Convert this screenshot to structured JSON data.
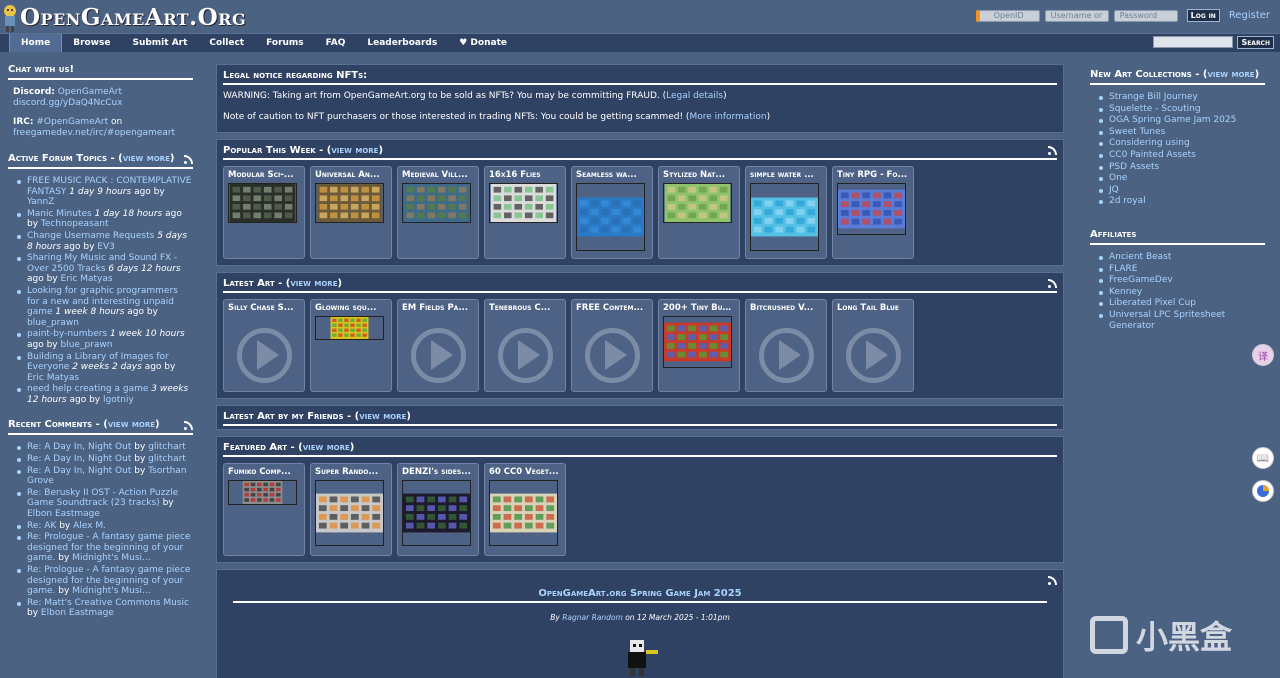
{
  "site": {
    "title": "OpenGameArt.Org"
  },
  "login": {
    "openid_placeholder": "OpenID",
    "username_placeholder": "Username or",
    "password_placeholder": "Password",
    "login_label": "Log in",
    "register_label": "Register"
  },
  "nav": {
    "items": [
      "Home",
      "Browse",
      "Submit Art",
      "Collect",
      "Forums",
      "FAQ",
      "Leaderboards",
      "♥ Donate"
    ],
    "search_label": "Search"
  },
  "chat": {
    "heading": "Chat with us!",
    "discord_label": "Discord:",
    "discord_name": "OpenGameArt",
    "discord_link": "discord.gg/yDaQ4NcCux",
    "irc_label": "IRC:",
    "irc_channel": "#OpenGameArt",
    "irc_on": "on",
    "irc_link": "freegamedev.net/irc/#opengameart"
  },
  "forum": {
    "heading": "Active Forum Topics - (",
    "view_more": "view more",
    "close": ")",
    "items": [
      {
        "title": "FREE MUSIC PACK : CONTEMPLATIVE FANTASY",
        "time": "1 day 9 hours",
        "ago": "ago by",
        "user": "YannZ"
      },
      {
        "title": "Manic Minutes",
        "time": "1 day 18 hours",
        "ago": "ago by",
        "user": "Technopeasant"
      },
      {
        "title": "Change Username Requests",
        "time": "5 days 8 hours",
        "ago": "ago by",
        "user": "EV3"
      },
      {
        "title": "Sharing My Music and Sound FX - Over 2500 Tracks",
        "time": "6 days 12 hours",
        "ago": "ago by",
        "user": "Eric Matyas"
      },
      {
        "title": "Looking for graphic programmers for a new and interesting unpaid game",
        "time": "1 week 8 hours",
        "ago": "ago by",
        "user": "blue_prawn"
      },
      {
        "title": "paint-by-numbers",
        "time": "1 week 10 hours",
        "ago": "ago by",
        "user": "blue_prawn"
      },
      {
        "title": "Building a Library of Images for Everyone",
        "time": "2 weeks 2 days",
        "ago": "ago by",
        "user": "Eric Matyas"
      },
      {
        "title": "need help creating a game",
        "time": "3 weeks 12 hours",
        "ago": "ago by",
        "user": "lgotniy"
      }
    ]
  },
  "comments": {
    "heading": "Recent Comments - (",
    "view_more": "view more",
    "close": ")",
    "items": [
      {
        "title": "Re: A Day In, Night Out",
        "by": "by",
        "user": "glitchart"
      },
      {
        "title": "Re: A Day In, Night Out",
        "by": "by",
        "user": "glitchart"
      },
      {
        "title": "Re: A Day In, Night Out",
        "by": "by",
        "user": "Tsorthan Grove"
      },
      {
        "title": "Re: Berusky II OST - Action Puzzle Game Soundtrack (23 tracks)",
        "by": "by",
        "user": "Elbon Eastmage"
      },
      {
        "title": "Re: AK",
        "by": "by",
        "user": "Alex M."
      },
      {
        "title": "Re: Prologue - A fantasy game piece designed for the beginning of your game.",
        "by": "by",
        "user": "Midnight's Musi..."
      },
      {
        "title": "Re: Prologue - A fantasy game piece designed for the beginning of your game.",
        "by": "by",
        "user": "Midnight's Musi..."
      },
      {
        "title": "Re: Matt's Creative Commons Music",
        "by": "by",
        "user": "Elbon Eastmage"
      }
    ]
  },
  "legal": {
    "heading": "Legal notice regarding NFTs:",
    "warning": "WARNING: Taking art from OpenGameArt.org to be sold as NFTs? You may be committing FRAUD. (",
    "warning_link": "Legal details",
    "note": "Note of caution to NFT purchasers or those interested in trading NFTs: You could be getting scammed! (",
    "note_link": "More information",
    "close": ")"
  },
  "popular": {
    "heading": "Popular This Week - (",
    "view_more": "view more",
    "close": ")",
    "items": [
      {
        "title": "Modular Sci-...",
        "colors": [
          "#2b2f2a",
          "#5d6a55",
          "#8b9a86"
        ]
      },
      {
        "title": "Universal An...",
        "colors": [
          "#6b5a3a",
          "#d9a441",
          "#e7c06a"
        ]
      },
      {
        "title": "Medieval Vill...",
        "colors": [
          "#3e6b8a",
          "#5b7f3a",
          "#9b7c52"
        ]
      },
      {
        "title": "16x16 Flies",
        "colors": [
          "#dcdcdc",
          "#3b3b3b",
          "#6dbf7b"
        ]
      },
      {
        "title": "Seamless wa...",
        "colors": [
          "#2a7ac8",
          "#3a8fd8",
          "#2b6db3"
        ]
      },
      {
        "title": "Stylized Nat...",
        "colors": [
          "#8fc36b",
          "#d8c48a",
          "#6b9b49"
        ]
      },
      {
        "title": "simple water ...",
        "colors": [
          "#55c0e6",
          "#2aa1d4",
          "#8fd8f0"
        ]
      },
      {
        "title": "Tiny RPG - Fo...",
        "colors": [
          "#5a7bd6",
          "#2e4fae",
          "#c44"
        ]
      }
    ]
  },
  "latest": {
    "heading": "Latest Art - (",
    "view_more": "view more",
    "close": ")",
    "items": [
      {
        "title": "Silly Chase S...",
        "kind": "audio"
      },
      {
        "title": "Glowing squ...",
        "kind": "image",
        "colors": [
          "#d8c41a",
          "#c83b2b",
          "#46a83a"
        ]
      },
      {
        "title": "EM Fields Pa...",
        "kind": "audio"
      },
      {
        "title": "Tenebrous C...",
        "kind": "audio"
      },
      {
        "title": "FREE Contem...",
        "kind": "audio"
      },
      {
        "title": "200+ Tiny But...",
        "kind": "image",
        "colors": [
          "#c83b2b",
          "#46a83a",
          "#3b6bd6"
        ]
      },
      {
        "title": "Bitcrushed V...",
        "kind": "audio"
      },
      {
        "title": "Long Tail Blue",
        "kind": "audio"
      }
    ]
  },
  "friends": {
    "heading": "Latest Art by my Friends - (",
    "view_more": "view more",
    "close": ")"
  },
  "featured": {
    "heading": "Featured Art - (",
    "view_more": "view more",
    "close": ")",
    "items": [
      {
        "title": "Fumiko Comp...",
        "colors": [
          "#8c8c8c",
          "#c02020",
          "#2b2b2b"
        ]
      },
      {
        "title": "Super Rando...",
        "colors": [
          "#c8c8c8",
          "#e28a2b",
          "#3b3b3b"
        ]
      },
      {
        "title": "DENZI's sides...",
        "colors": [
          "#1b1b2b",
          "#3b6b3b",
          "#6b6bd6"
        ]
      },
      {
        "title": "60 CC0 Veget...",
        "colors": [
          "#d8d2b8",
          "#3b8b3b",
          "#c84b2b"
        ]
      }
    ]
  },
  "news": {
    "title": "OpenGameArt.org Spring Game Jam 2025",
    "by": "By",
    "author": "Ragnar Random",
    "date": "on 12 March 2025 - 1:01pm"
  },
  "collections": {
    "heading": "New Art Collections - (",
    "view_more": "view more",
    "close": ")",
    "items": [
      "Strange Bill Journey",
      "Squelette - Scouting",
      "OGA Spring Game Jam 2025",
      "Sweet Tunes",
      "Considering using",
      "CC0 Painted Assets",
      "PSD Assets",
      "One",
      "JQ",
      "2d royal"
    ]
  },
  "affiliates": {
    "heading": "Affiliates",
    "items": [
      "Ancient Beast",
      "FLARE",
      "FreeGameDev",
      "Kenney",
      "Liberated Pixel Cup",
      "Universal LPC Spritesheet Generator"
    ]
  },
  "watermark": {
    "text": "小黑盒"
  },
  "side_tools": {
    "translate": "译",
    "read": "📖"
  }
}
